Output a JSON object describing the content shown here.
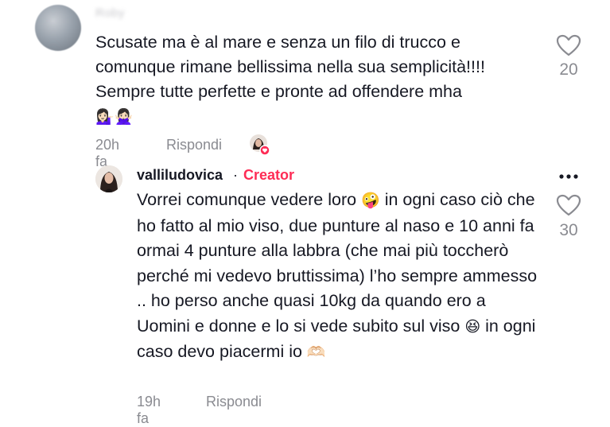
{
  "comment": {
    "username": "Roby",
    "text": "Scusate ma è al mare e senza un filo di trucco e comunque rimane bellissima nella sua semplicità!!!! Sempre tutte perfette e pronte ad offendere mha",
    "emojis": "💁🏻‍♀️🙅🏻‍♀️",
    "time": "20h fa",
    "reply_label": "Rispondi",
    "like_count": "20",
    "liked_by_creator": true
  },
  "reply": {
    "username": "valliludovica",
    "separator": "·",
    "badge": "Creator",
    "text_parts": [
      "Vorrei comunque vedere loro ",
      "🤪",
      " in ogni caso ciò che ho fatto al mio viso, due punture al naso e 10 anni fa ormai 4 punture alla labbra (che mai più toccherò perché mi vedevo bruttissima) l’ho sempre ammesso .. ho perso anche quasi 10kg da quando ero a Uomini e donne e lo si vede subito sul viso ",
      "😆",
      " in ogni caso devo piacermi io ",
      "🫶🏻"
    ],
    "time": "19h fa",
    "reply_label": "Rispondi",
    "like_count": "30",
    "more_icon": "more-horizontal-icon"
  },
  "colors": {
    "text": "#161823",
    "muted": "#8a8b91",
    "creator_badge": "#fe2c55"
  }
}
